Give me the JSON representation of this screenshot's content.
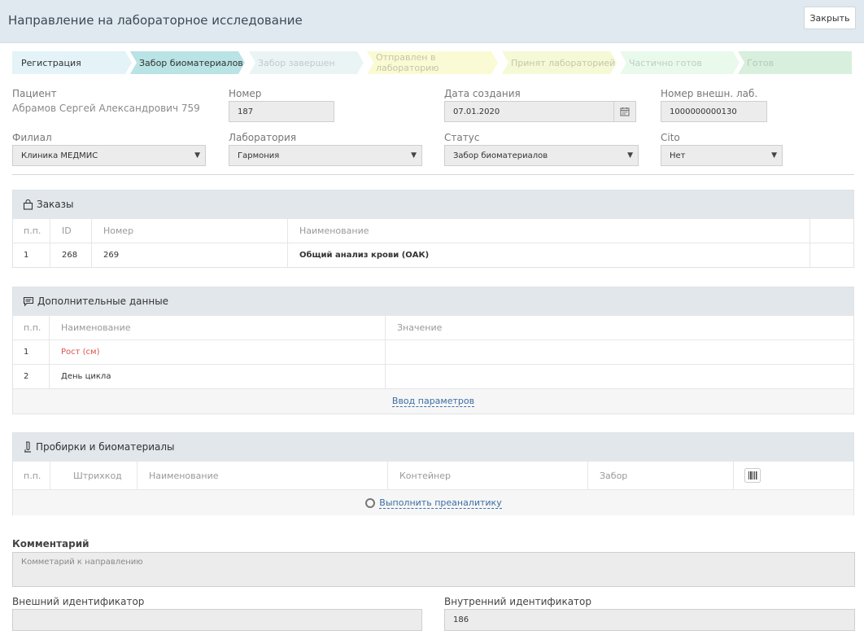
{
  "header": {
    "title": "Направление на лабораторное исследование",
    "close_label": "Закрыть"
  },
  "steps": [
    {
      "label": "Регистрация",
      "bg": "#e3f3f8",
      "color": "#333333"
    },
    {
      "label": "Забор биоматериалов",
      "bg": "#b9e3e4",
      "color": "#333333"
    },
    {
      "label": "Забор завершен",
      "bg": "#eaf4f5",
      "color": "#c3c9cc"
    },
    {
      "label": "Отправлен в лабораторию",
      "bg": "#fafbd4",
      "color": "#c5c5a7"
    },
    {
      "label": "Принят лабораторией",
      "bg": "#f6f9d6",
      "color": "#c5c8aa"
    },
    {
      "label": "Частично готов",
      "bg": "#e9f9ec",
      "color": "#bbd0c0"
    },
    {
      "label": "Готов",
      "bg": "#d7efdc",
      "color": "#b6c9bb"
    }
  ],
  "form": {
    "patient_label": "Пациент",
    "patient_value": "Абрамов Сергей Александрович 759",
    "number_label": "Номер",
    "number_value": "187",
    "created_label": "Дата создания",
    "created_value": "07.01.2020",
    "ext_lab_label": "Номер внешн. лаб.",
    "ext_lab_value": "1000000000130",
    "branch_label": "Филиал",
    "branch_value": "Клиника МЕДМИС",
    "lab_label": "Лаборатория",
    "lab_value": "Гармония",
    "status_label": "Статус",
    "status_value": "Забор биоматериалов",
    "cito_label": "Cito",
    "cito_value": "Нет"
  },
  "orders": {
    "title": "Заказы",
    "headers": [
      "п.п.",
      "ID",
      "Номер",
      "Наименование"
    ],
    "rows": [
      {
        "n": "1",
        "id": "268",
        "num": "269",
        "name": "Общий анализ крови (ОАК)"
      }
    ]
  },
  "extra": {
    "title": "Дополнительные данные",
    "headers": [
      "п.п.",
      "Наименование",
      "Значение"
    ],
    "rows": [
      {
        "n": "1",
        "name": "Рост (см)",
        "value": ""
      },
      {
        "n": "2",
        "name": "День цикла",
        "value": ""
      }
    ],
    "footer_link": "Ввод параметров"
  },
  "tubes": {
    "title": "Пробирки и биоматериалы",
    "headers": [
      "п.п.",
      "Штрихкод",
      "Наименование",
      "Контейнер",
      "Забор"
    ],
    "footer_link": "Выполнить преаналитику"
  },
  "comment": {
    "label": "Комментарий",
    "placeholder": "Комметарий к направлению"
  },
  "ext_id": {
    "label": "Внешний идентификатор",
    "value": ""
  },
  "int_id": {
    "label": "Внутренний идентификатор",
    "value": "186"
  }
}
